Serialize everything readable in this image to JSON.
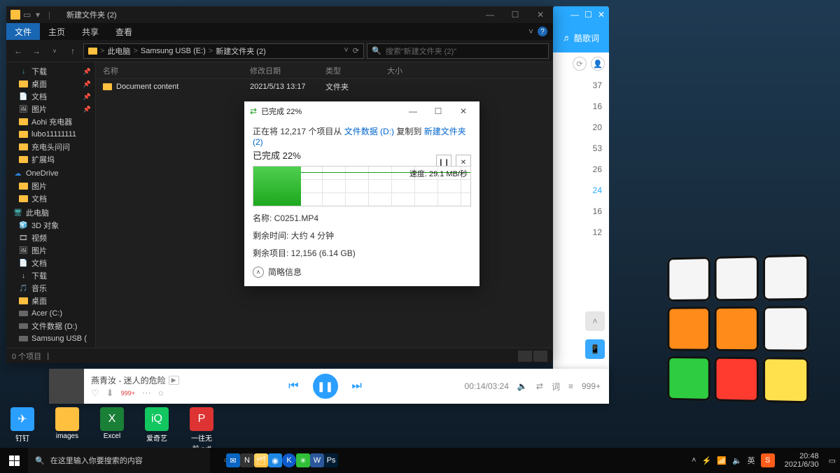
{
  "titlebar": {
    "title": "新建文件夹 (2)",
    "min": "—",
    "max": "☐",
    "close": "✕"
  },
  "ribbon": {
    "file": "文件",
    "home": "主页",
    "share": "共享",
    "view": "查看",
    "expand": "˅",
    "help": "?"
  },
  "nav": {
    "back": "←",
    "fwd": "→",
    "down": "˅",
    "up": "↑",
    "crumbs": [
      "此电脑",
      "Samsung USB (E:)",
      "新建文件夹 (2)"
    ],
    "refresh": "⟳",
    "search_placeholder": "搜索\"新建文件夹 (2)\"",
    "search_icon": "🔍"
  },
  "navpane": {
    "quick": [
      {
        "icon": "↓",
        "cls": "ic-dl",
        "label": "下载",
        "pin": "📌"
      },
      {
        "icon": "",
        "cls": "ic-folder",
        "label": "桌面",
        "pin": "📌"
      },
      {
        "icon": "📄",
        "cls": "",
        "label": "文档",
        "pin": "📌"
      },
      {
        "icon": "🖼",
        "cls": "",
        "label": "图片",
        "pin": "📌"
      },
      {
        "icon": "",
        "cls": "ic-folder",
        "label": "Aohi 充电器",
        "pin": ""
      },
      {
        "icon": "",
        "cls": "ic-folder",
        "label": "lubo11111111",
        "pin": ""
      },
      {
        "icon": "",
        "cls": "ic-folder",
        "label": "充电头问问",
        "pin": ""
      },
      {
        "icon": "",
        "cls": "ic-folder",
        "label": "扩展坞",
        "pin": ""
      }
    ],
    "onedrive": {
      "label": "OneDrive",
      "items": [
        {
          "label": "图片"
        },
        {
          "label": "文档"
        }
      ]
    },
    "thispc": {
      "label": "此电脑",
      "items": [
        {
          "icon": "🧊",
          "label": "3D 对象"
        },
        {
          "icon": "🎞",
          "label": "视频"
        },
        {
          "icon": "🖼",
          "label": "图片"
        },
        {
          "icon": "📄",
          "label": "文档"
        },
        {
          "icon": "↓",
          "label": "下载"
        },
        {
          "icon": "🎵",
          "label": "音乐"
        },
        {
          "icon": "",
          "cls": "ic-folder",
          "label": "桌面"
        },
        {
          "icon": "",
          "cls": "ic-drive",
          "label": "Acer (C:)"
        },
        {
          "icon": "",
          "cls": "ic-drive",
          "label": "文件数据 (D:)"
        },
        {
          "icon": "",
          "cls": "ic-drive",
          "label": "Samsung USB ("
        }
      ]
    }
  },
  "cols": {
    "name": "名称",
    "date": "修改日期",
    "type": "类型",
    "size": "大小"
  },
  "rows": [
    {
      "name": "Document content",
      "date": "2021/5/13 13:17",
      "type": "文件夹",
      "size": ""
    }
  ],
  "status": {
    "count": "0 个项目"
  },
  "copy": {
    "ic": "⇄",
    "title": "已完成 22%",
    "min": "—",
    "max": "☐",
    "close": "✕",
    "line_pre": "正在将 12,217 个项目从 ",
    "src": "文件数据 (D:)",
    "mid": " 复制到 ",
    "dst": "新建文件夹 (2)",
    "done": "已完成 22%",
    "pause": "❙❙",
    "stop": "✕",
    "speed": "速度: 29.1 MB/秒",
    "d_name": "名称: C0251.MP4",
    "d_time": "剩余时间: 大约 4 分钟",
    "d_items": "剩余项目: 12,156 (6.14 GB)",
    "less_icon": "˄",
    "less": "简略信息"
  },
  "sideapp": {
    "min": "—",
    "max": "☐",
    "close": "✕",
    "tab_icon": "♬",
    "tab": "酷歌词",
    "tool1": "⟳",
    "tool2": "👤",
    "lines": [
      "37",
      "16",
      "20",
      "53",
      "26",
      "24",
      "16",
      "12"
    ],
    "up": "˄",
    "phone": "📱"
  },
  "player": {
    "title": "燕青汝 - 迷人的危险",
    "mv": "▶",
    "heart": "♡",
    "dl": "⬇",
    "badge": "999+",
    "more": "⋯",
    "ring": "○",
    "prev": "⏮",
    "pause": "❚❚",
    "next": "⏭",
    "time": "00:14/03:24",
    "vol": "🔈",
    "loop": "⇄",
    "lyr": "词",
    "list": "≡",
    "count": "999+"
  },
  "desktop_icons": [
    {
      "cls": "g-ding",
      "g": "✈",
      "label": "钉钉"
    },
    {
      "cls": "g-fold",
      "g": "",
      "label": "images"
    },
    {
      "cls": "g-xls",
      "g": "X",
      "label": "Excel"
    },
    {
      "cls": "g-iq",
      "g": "iQ",
      "label": "爱奇艺"
    },
    {
      "cls": "g-pdf",
      "g": "P",
      "label": "一往无前.pdf"
    }
  ],
  "taskbar": {
    "search_icon": "🔍",
    "search": "在这里输入你要搜索的内容",
    "cortana": "○",
    "tasks": "⧉",
    "apps": [
      {
        "cls": "ti-mail",
        "t": "✉"
      },
      {
        "cls": "ti-n",
        "t": "N"
      },
      {
        "cls": "ti-ie",
        "t": "🗂"
      },
      {
        "cls": "ti-edge",
        "t": "◉"
      },
      {
        "cls": "ti-k",
        "t": "K"
      },
      {
        "cls": "ti-wc",
        "t": "✳"
      },
      {
        "cls": "ti-wd",
        "t": "W"
      },
      {
        "cls": "ti-ps",
        "t": "Ps"
      }
    ],
    "tray": {
      "up": "˄",
      "wifi": "📶",
      "batt": "⚡",
      "snd": "🔈",
      "ime": "英"
    },
    "sogou": "S",
    "time": "20:48",
    "date": "2021/6/30",
    "notif": "▭"
  }
}
